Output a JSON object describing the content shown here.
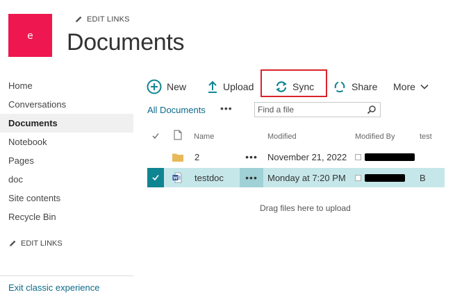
{
  "site": {
    "logo_letter": "e",
    "edit_links": "EDIT LINKS",
    "title": "Documents"
  },
  "nav": {
    "items": [
      "Home",
      "Conversations",
      "Documents",
      "Notebook",
      "Pages",
      "doc",
      "Site contents",
      "Recycle Bin"
    ],
    "selected_index": 2,
    "edit_links": "EDIT LINKS",
    "exit_classic": "Exit classic experience"
  },
  "commands": {
    "new": "New",
    "upload": "Upload",
    "sync": "Sync",
    "share": "Share",
    "more": "More"
  },
  "view": {
    "name": "All Documents",
    "ellipsis": "•••",
    "search_placeholder": "Find a file"
  },
  "table": {
    "columns": {
      "name": "Name",
      "modified": "Modified",
      "modified_by": "Modified By",
      "test": "test"
    },
    "rows": [
      {
        "type": "folder",
        "name": "2",
        "modified": "November 21, 2022",
        "modified_by": "",
        "test": "",
        "selected": false
      },
      {
        "type": "word-document",
        "name": "testdoc",
        "modified": "Monday at 7:20 PM",
        "modified_by": "",
        "test": "B",
        "selected": true
      }
    ],
    "row_ellipsis": "•••"
  },
  "drag_hint": "Drag files here to upload",
  "colors": {
    "logo": "#ee1750",
    "accent": "#0f8591",
    "link": "#0b6a8a",
    "selected_row": "#c6e7ea",
    "highlight_box": "#d8232a"
  }
}
